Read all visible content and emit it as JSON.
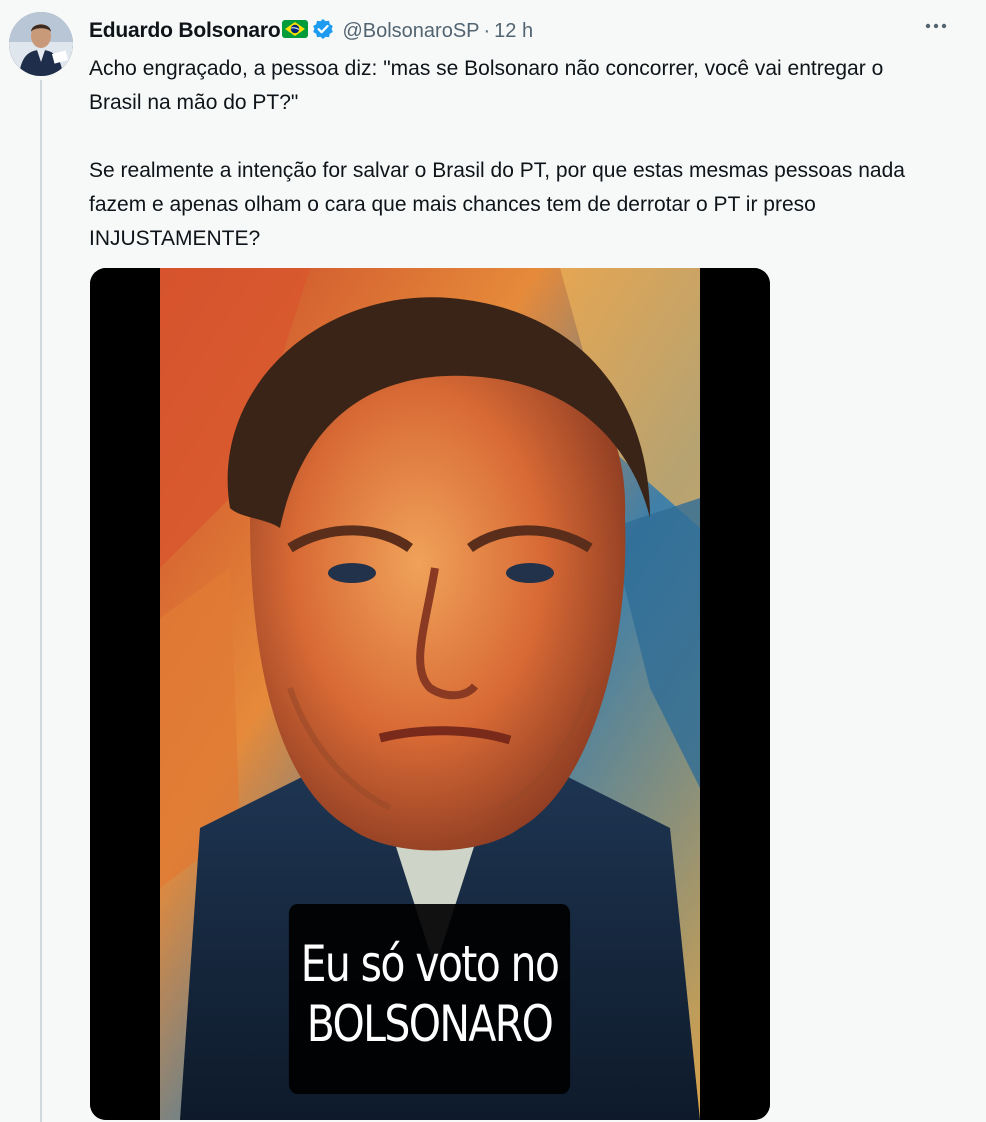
{
  "tweet": {
    "author": {
      "display_name": "Eduardo Bolsonaro",
      "handle": "@BolsonaroSP",
      "separator": "·",
      "time": "12 h"
    },
    "paragraphs": [
      "Acho engraçado, a pessoa diz: \"mas se Bolsonaro não concorrer, você vai entregar o Brasil na mão do PT?\"",
      "Se realmente a intenção for salvar o Brasil do PT, por que estas mesmas pessoas nada fazem e apenas olham o cara que mais chances tem de derrotar o PT ir preso INJUSTAMENTE?"
    ],
    "media": {
      "caption_line1": "Eu só voto no",
      "caption_line2": "BOLSONARO"
    }
  },
  "icons": {
    "flag": "brazil-flag-emoji",
    "verified": "verified-badge",
    "more": "more-options"
  },
  "colors": {
    "background": "#f7f9f9",
    "text": "#0f1419",
    "secondary": "#536471",
    "verified": "#1d9bf0"
  }
}
